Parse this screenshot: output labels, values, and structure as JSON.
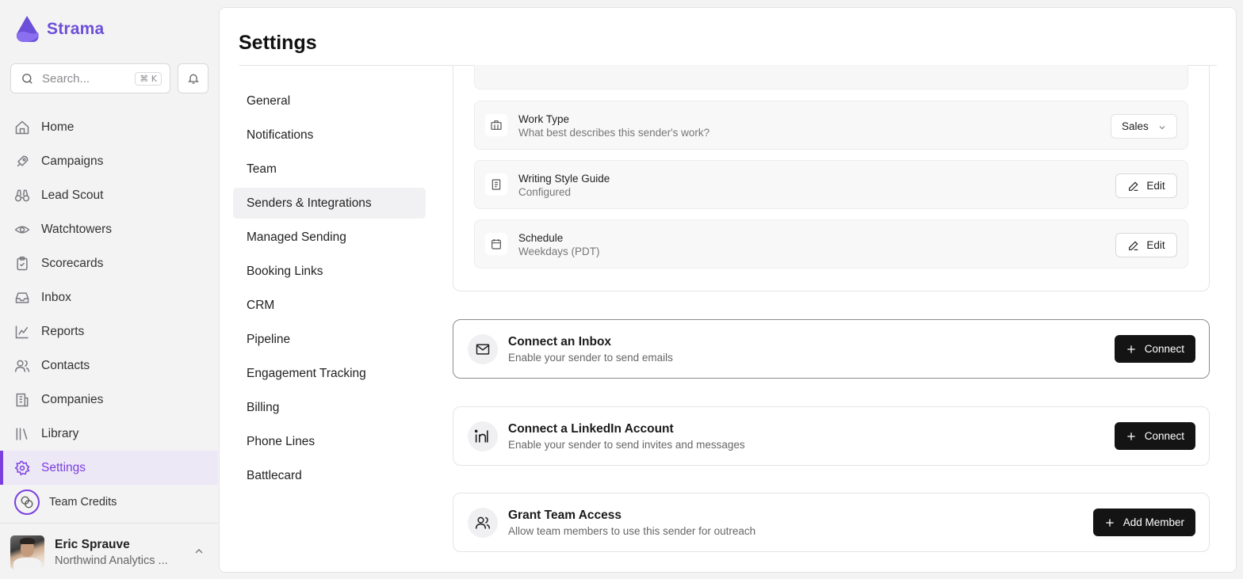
{
  "app": {
    "name": "Strama"
  },
  "search": {
    "placeholder": "Search...",
    "shortcut": "⌘ K"
  },
  "sidebar": {
    "items": [
      {
        "label": "Home",
        "icon": "home-icon"
      },
      {
        "label": "Campaigns",
        "icon": "rocket-icon"
      },
      {
        "label": "Lead Scout",
        "icon": "binoculars-icon"
      },
      {
        "label": "Watchtowers",
        "icon": "eye-icon"
      },
      {
        "label": "Scorecards",
        "icon": "clipboard-icon"
      },
      {
        "label": "Inbox",
        "icon": "inbox-icon"
      },
      {
        "label": "Reports",
        "icon": "chart-line-icon"
      },
      {
        "label": "Contacts",
        "icon": "users-icon"
      },
      {
        "label": "Companies",
        "icon": "building-icon"
      },
      {
        "label": "Library",
        "icon": "library-icon"
      },
      {
        "label": "Settings",
        "icon": "gear-icon",
        "active": true
      }
    ],
    "credits_label": "Team Credits"
  },
  "user": {
    "name": "Eric Sprauve",
    "org": "Northwind Analytics ..."
  },
  "page": {
    "title": "Settings"
  },
  "settings_menu": [
    "General",
    "Notifications",
    "Team",
    "Senders & Integrations",
    "Managed Sending",
    "Booking Links",
    "CRM",
    "Pipeline",
    "Engagement Tracking",
    "Billing",
    "Phone Lines",
    "Battlecard"
  ],
  "settings_menu_active": "Senders & Integrations",
  "sender": {
    "work_type": {
      "title": "Work Type",
      "subtitle": "What best describes this sender's work?",
      "value": "Sales"
    },
    "writing_style": {
      "title": "Writing Style Guide",
      "subtitle": "Configured",
      "button": "Edit"
    },
    "schedule": {
      "title": "Schedule",
      "subtitle": "Weekdays (PDT)",
      "button": "Edit"
    }
  },
  "cards": {
    "inbox": {
      "title": "Connect an Inbox",
      "subtitle": "Enable your sender to send emails",
      "button": "Connect"
    },
    "linkedin": {
      "title": "Connect a LinkedIn Account",
      "subtitle": "Enable your sender to send invites and messages",
      "button": "Connect"
    },
    "team": {
      "title": "Grant Team Access",
      "subtitle": "Allow team members to use this sender for outreach",
      "button": "Add Member"
    }
  },
  "colors": {
    "brand": "#6b4fd8",
    "accent": "#7b3fe0",
    "button_dark": "#141414"
  }
}
